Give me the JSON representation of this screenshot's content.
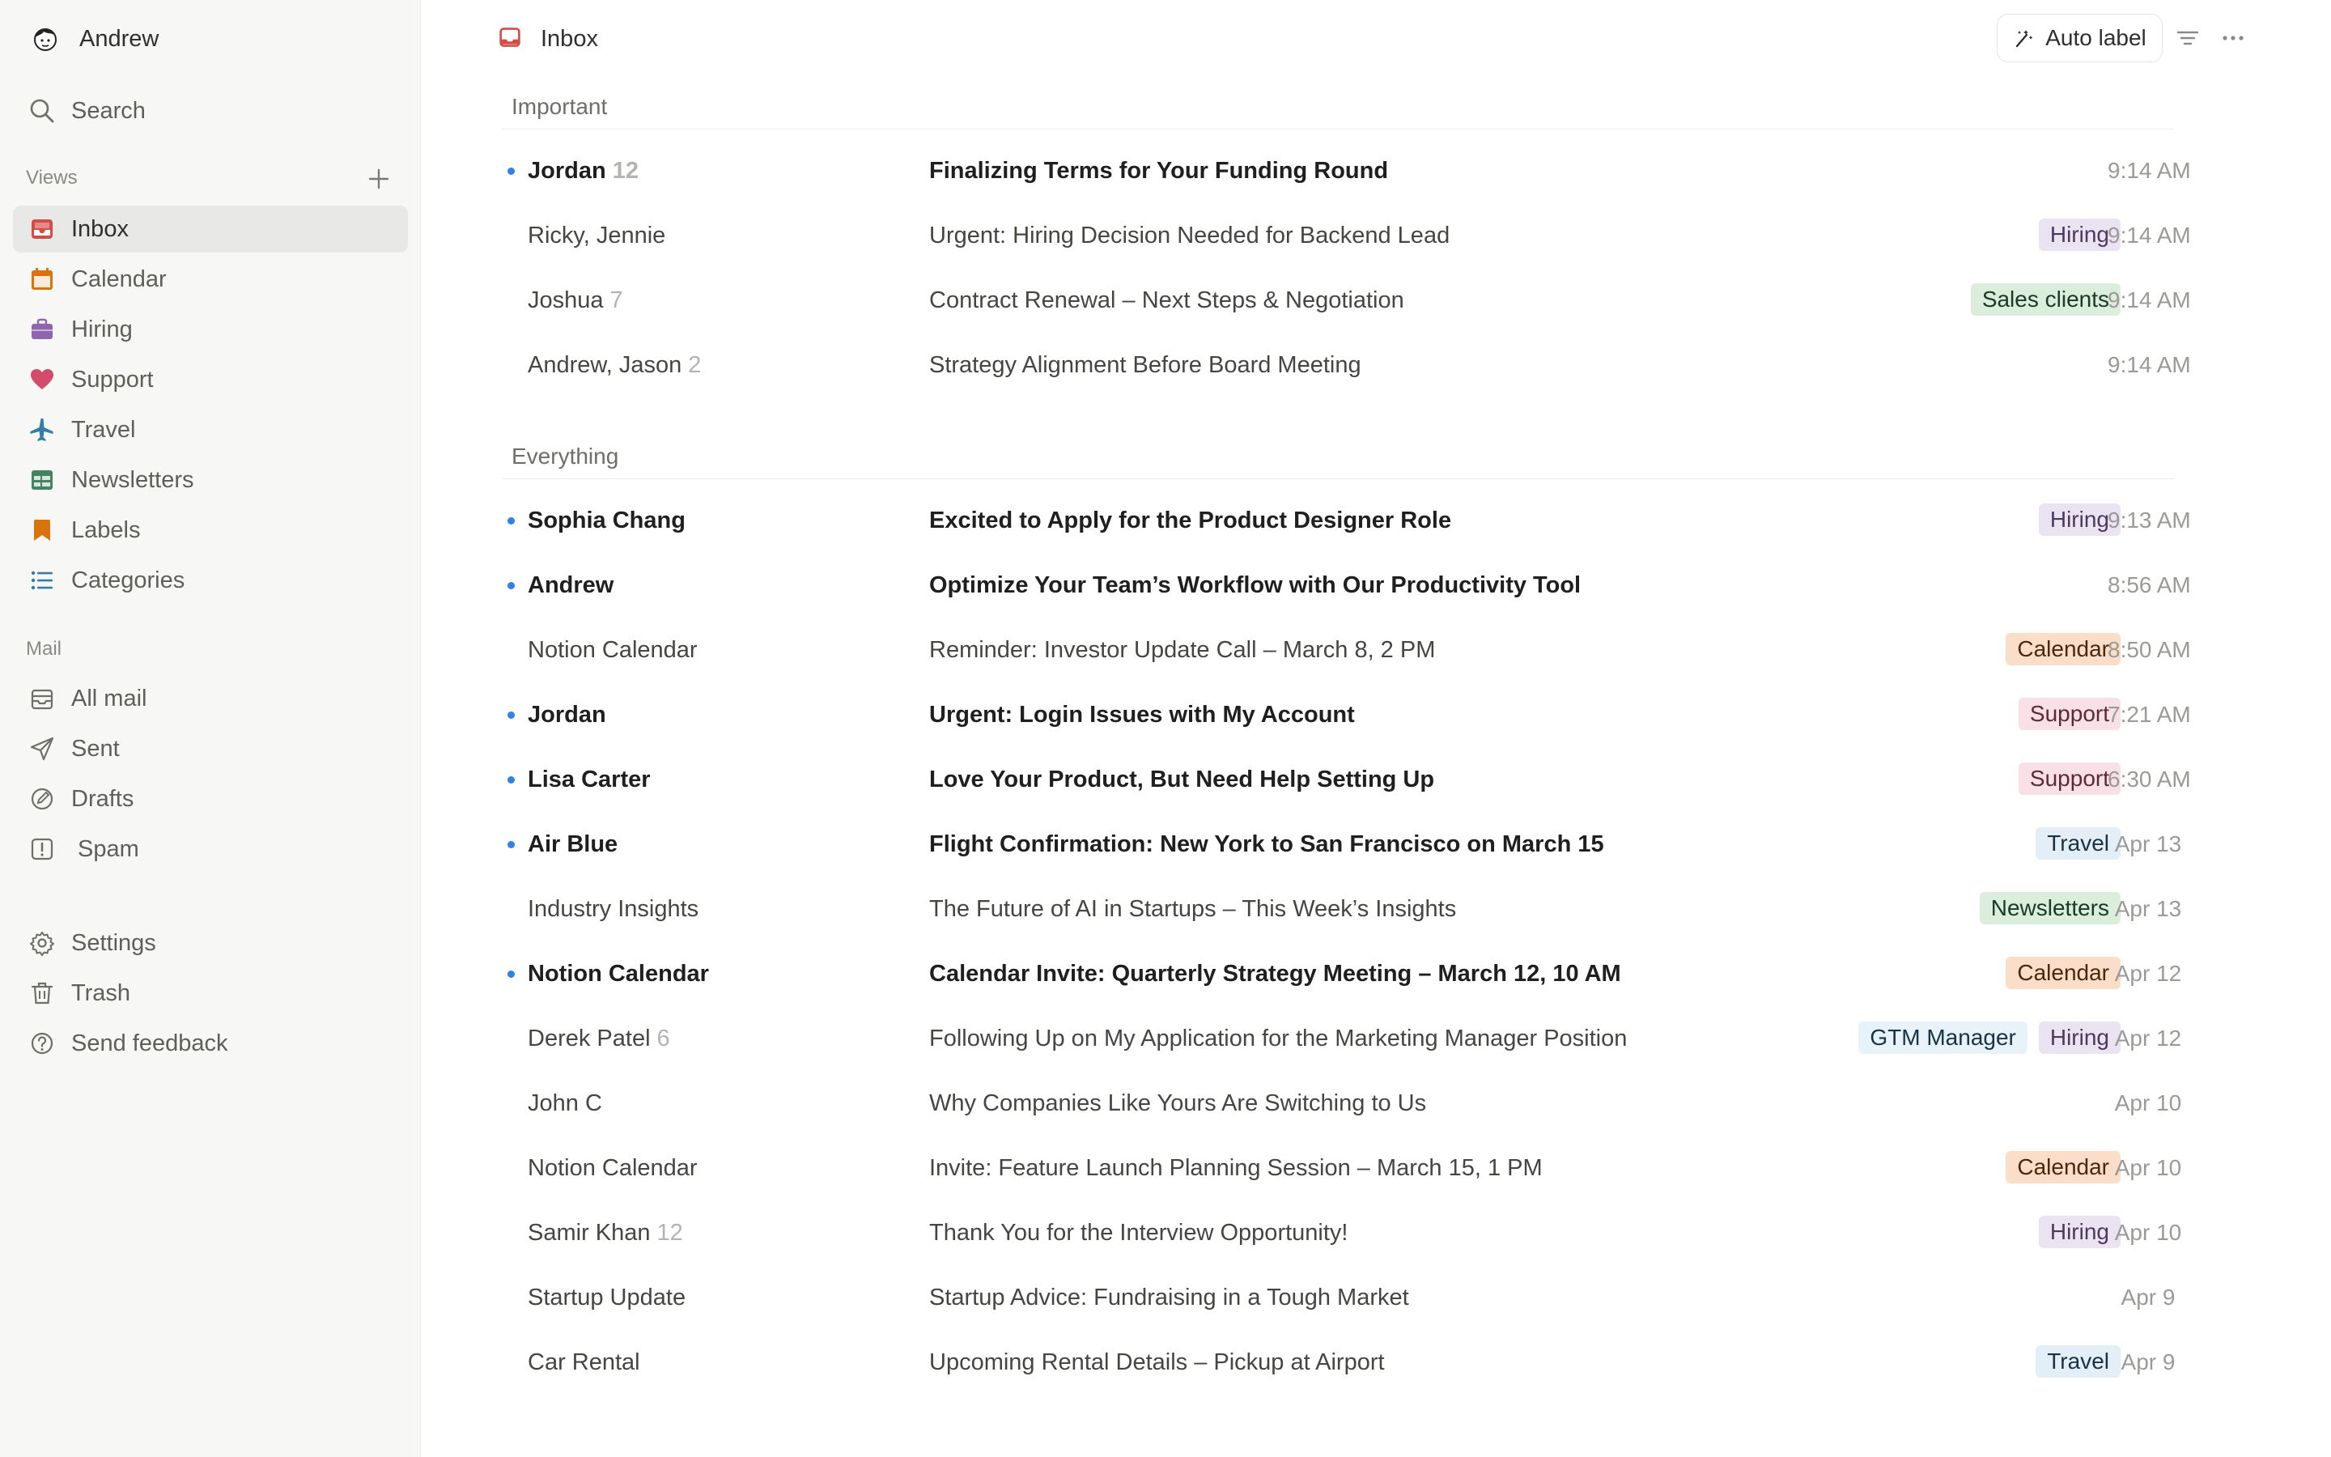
{
  "account": {
    "name": "Andrew"
  },
  "sidebar": {
    "search_label": "Search",
    "views_label": "Views",
    "views": [
      {
        "label": "Inbox",
        "icon": "inbox-icon",
        "color": "#d44c47"
      },
      {
        "label": "Calendar",
        "icon": "calendar-icon",
        "color": "#d9730d"
      },
      {
        "label": "Hiring",
        "icon": "briefcase-icon",
        "color": "#9065b0"
      },
      {
        "label": "Support",
        "icon": "heart-icon",
        "color": "#d44c6c"
      },
      {
        "label": "Travel",
        "icon": "airplane-icon",
        "color": "#337ea9"
      },
      {
        "label": "Newsletters",
        "icon": "table-icon",
        "color": "#448361"
      },
      {
        "label": "Labels",
        "icon": "bookmark-icon",
        "color": "#d9730d"
      },
      {
        "label": "Categories",
        "icon": "list-icon",
        "color": "#337ea9"
      }
    ],
    "mail_label": "Mail",
    "mail": [
      {
        "label": "All mail",
        "icon": "archive-icon"
      },
      {
        "label": "Sent",
        "icon": "send-icon"
      },
      {
        "label": "Drafts",
        "icon": "draft-icon"
      },
      {
        "label": "Spam",
        "icon": "spam-icon"
      }
    ],
    "footer": [
      {
        "label": "Settings",
        "icon": "gear-icon"
      },
      {
        "label": "Trash",
        "icon": "trash-icon"
      },
      {
        "label": "Send feedback",
        "icon": "help-icon"
      }
    ]
  },
  "header": {
    "title": "Inbox",
    "auto_label": "Auto label"
  },
  "tag_colors": {
    "Hiring": {
      "bg": "#eae4f2",
      "fg": "#4a3a5f"
    },
    "Sales clients": {
      "bg": "#dbeddb",
      "fg": "#1c3829"
    },
    "Calendar": {
      "bg": "#fadec9",
      "fg": "#49290e"
    },
    "Support": {
      "bg": "#f8e0e6",
      "fg": "#5c2a36"
    },
    "Travel": {
      "bg": "#e3eef7",
      "fg": "#183347"
    },
    "Newsletters": {
      "bg": "#dbeddb",
      "fg": "#1c3829"
    },
    "GTM Manager": {
      "bg": "#e7f3f8",
      "fg": "#183347"
    }
  },
  "groups": [
    {
      "title": "Important",
      "rows": [
        {
          "sender": "Jordan",
          "count": "12",
          "subject": "Finalizing Terms for Your Funding Round",
          "tags": [],
          "time": "9:14 AM",
          "unread": true
        },
        {
          "sender": "Ricky, Jennie",
          "count": "",
          "subject": "Urgent: Hiring Decision Needed for Backend Lead",
          "tags": [
            "Hiring"
          ],
          "time": "9:14 AM",
          "unread": false
        },
        {
          "sender": "Joshua",
          "count": "7",
          "subject": "Contract Renewal – Next Steps & Negotiation",
          "tags": [
            "Sales clients"
          ],
          "time": "9:14 AM",
          "unread": false
        },
        {
          "sender": "Andrew, Jason",
          "count": "2",
          "subject": "Strategy Alignment Before Board Meeting",
          "tags": [],
          "time": "9:14 AM",
          "unread": false
        }
      ]
    },
    {
      "title": "Everything",
      "rows": [
        {
          "sender": "Sophia Chang",
          "count": "",
          "subject": "Excited to Apply for the Product Designer Role",
          "tags": [
            "Hiring"
          ],
          "time": "9:13 AM",
          "unread": true
        },
        {
          "sender": "Andrew",
          "count": "",
          "subject": "Optimize Your Team’s Workflow with Our Productivity Tool",
          "tags": [],
          "time": "8:56 AM",
          "unread": true
        },
        {
          "sender": "Notion Calendar",
          "count": "",
          "subject": "Reminder: Investor Update Call – March 8, 2 PM",
          "tags": [
            "Calendar"
          ],
          "time": "8:50 AM",
          "unread": false
        },
        {
          "sender": "Jordan",
          "count": "",
          "subject": "Urgent: Login Issues with My Account",
          "tags": [
            "Support"
          ],
          "time": "7:21 AM",
          "unread": true
        },
        {
          "sender": "Lisa Carter",
          "count": "",
          "subject": "Love Your Product, But Need Help Setting Up",
          "tags": [
            "Support"
          ],
          "time": "6:30 AM",
          "unread": true
        },
        {
          "sender": "Air Blue",
          "count": "",
          "subject": "Flight Confirmation: New York to San Francisco on March 15",
          "tags": [
            "Travel"
          ],
          "time": "Apr 13",
          "unread": true
        },
        {
          "sender": "Industry Insights",
          "count": "",
          "subject": "The Future of AI in Startups – This Week’s Insights",
          "tags": [
            "Newsletters"
          ],
          "time": "Apr 13",
          "unread": false
        },
        {
          "sender": "Notion Calendar",
          "count": "",
          "subject": "Calendar Invite: Quarterly Strategy Meeting – March 12, 10 AM",
          "tags": [
            "Calendar"
          ],
          "time": "Apr 12",
          "unread": true
        },
        {
          "sender": "Derek Patel",
          "count": "6",
          "subject": "Following Up on My Application for the Marketing Manager Position",
          "tags": [
            "GTM Manager",
            "Hiring"
          ],
          "time": "Apr 12",
          "unread": false
        },
        {
          "sender": "John C",
          "count": "",
          "subject": "Why Companies Like Yours Are Switching to Us",
          "tags": [],
          "time": "Apr 10",
          "unread": false
        },
        {
          "sender": "Notion Calendar",
          "count": "",
          "subject": "Invite: Feature Launch Planning Session – March 15, 1 PM",
          "tags": [
            "Calendar"
          ],
          "time": "Apr 10",
          "unread": false
        },
        {
          "sender": "Samir Khan",
          "count": "12",
          "subject": "Thank You for the Interview Opportunity!",
          "tags": [
            "Hiring"
          ],
          "time": "Apr 10",
          "unread": false
        },
        {
          "sender": "Startup Update",
          "count": "",
          "subject": "Startup Advice: Fundraising in a Tough Market",
          "tags": [],
          "time": "Apr 9",
          "unread": false
        },
        {
          "sender": "Car Rental",
          "count": "",
          "subject": "Upcoming Rental Details – Pickup at Airport",
          "tags": [
            "Travel"
          ],
          "time": "Apr 9",
          "unread": false
        }
      ]
    }
  ]
}
